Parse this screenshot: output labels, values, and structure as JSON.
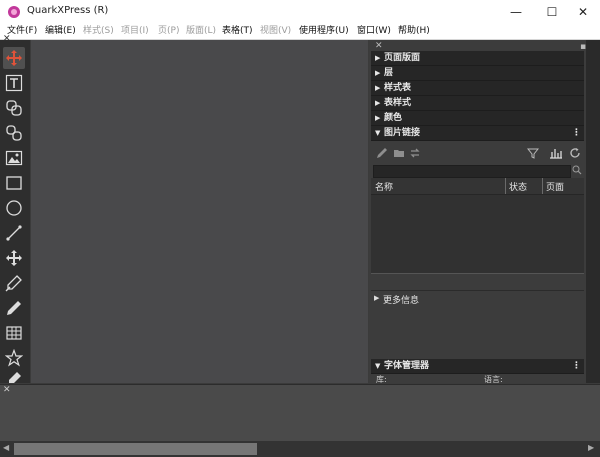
{
  "app": {
    "title": "QuarkXPress (R)"
  },
  "window_controls": {
    "minimize": "—",
    "maximize": "☐",
    "close": "✕"
  },
  "menu": [
    {
      "label": "文件(F)",
      "enabled": true
    },
    {
      "label": "编辑(E)",
      "enabled": true
    },
    {
      "label": "样式(S)",
      "enabled": false
    },
    {
      "label": "项目(I)",
      "enabled": false
    },
    {
      "label": "页(P)",
      "enabled": false
    },
    {
      "label": "版面(L)",
      "enabled": false
    },
    {
      "label": "表格(T)",
      "enabled": true
    },
    {
      "label": "视图(V)",
      "enabled": false
    },
    {
      "label": "使用程序(U)",
      "enabled": true
    },
    {
      "label": "窗口(W)",
      "enabled": true
    },
    {
      "label": "帮助(H)",
      "enabled": true
    }
  ],
  "tools": [
    {
      "name": "move-tool",
      "icon": "four-way-arrow-icon",
      "active": true
    },
    {
      "name": "text-content-tool",
      "icon": "text-box-icon"
    },
    {
      "name": "linking-tool",
      "icon": "link-chain-icon"
    },
    {
      "name": "unlinking-tool",
      "icon": "unlink-chain-icon"
    },
    {
      "name": "picture-content-tool",
      "icon": "picture-icon"
    },
    {
      "name": "rectangle-box-tool",
      "icon": "rectangle-icon"
    },
    {
      "name": "oval-box-tool",
      "icon": "circle-icon"
    },
    {
      "name": "line-tool",
      "icon": "line-icon"
    },
    {
      "name": "pan-tool",
      "icon": "arrows-icon"
    },
    {
      "name": "bezier-pen-tool",
      "icon": "pen-icon"
    },
    {
      "name": "freehand-tool",
      "icon": "pencil-icon"
    },
    {
      "name": "table-tool",
      "icon": "table-icon"
    },
    {
      "name": "starburst-tool",
      "icon": "star-icon"
    },
    {
      "name": "eyedropper-tool",
      "icon": "eyedropper-icon"
    }
  ],
  "palettes": {
    "page_layout": "页面版面",
    "layers": "层",
    "style_sheets": "样式表",
    "table_styles": "表样式",
    "colors": "颜色",
    "picture_links": "图片链接",
    "font_manager": "字体管理器",
    "kebab": "⋮"
  },
  "picture_links_table": {
    "columns": [
      "名称",
      "状态",
      "页面"
    ],
    "rows": []
  },
  "more_info": "更多信息",
  "font_manager_fields": {
    "library": "库:",
    "language": "语言:"
  },
  "colors": {
    "frame": "#3b3b3b",
    "canvas": "#49494b",
    "palette_header": "#262626",
    "accent_active_tool": "#e0533a",
    "app_icon": "#c2389b"
  }
}
